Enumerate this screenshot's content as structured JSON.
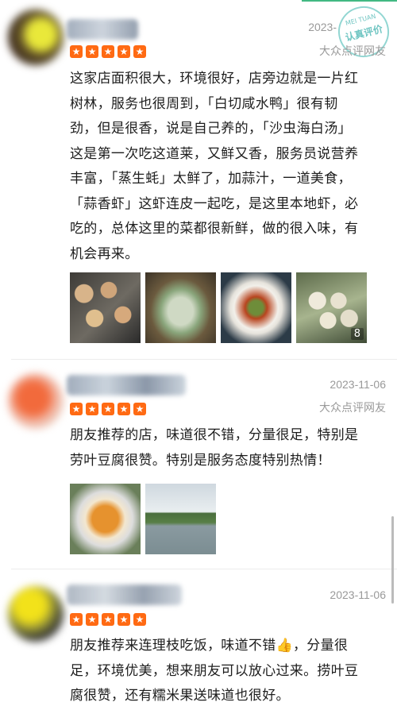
{
  "reviews": [
    {
      "date": "2023-",
      "source": "大众点评网友",
      "stars": 5,
      "lines": [
        "这家店面积很大，环境很好，店旁边就是一片红",
        "树林，服务也很周到，「白切咸水鸭」很有韧",
        "劲，但是很香，说是自己养的，「沙虫海白汤」",
        "这是第一次吃这道莱，又鲜又香，服务员说营养",
        "丰富，「蒸生蚝」太鲜了，加蒜汁，一道美食，",
        "「蒜香虾」这虾连皮一起吃，是这里本地虾，必",
        "吃的，总体这里的菜都很新鲜，做的很入味，有",
        "机会再来。"
      ],
      "photo_count": "8"
    },
    {
      "date": "2023-11-06",
      "source": "大众点评网友",
      "stars": 5,
      "lines": [
        "朋友推荐的店，味道很不错，分量很足，特别是",
        "劳叶豆腐很赞。特别是服务态度特别热情！"
      ]
    },
    {
      "date": "2023-11-06",
      "stars": 5,
      "lines": [
        "朋友推荐来连理枝吃饭，味道不错👍，分量很",
        "足，环境优美，想来朋友可以放心过来。捞叶豆",
        "腐很赞，还有糯米果送味道也很好。"
      ]
    }
  ],
  "stamp": {
    "line1": "MEI TUAN",
    "line2": "认真评价"
  },
  "colors": {
    "star": "#ff6a13",
    "meta_text": "#999999",
    "stamp": "#40b2ae"
  }
}
